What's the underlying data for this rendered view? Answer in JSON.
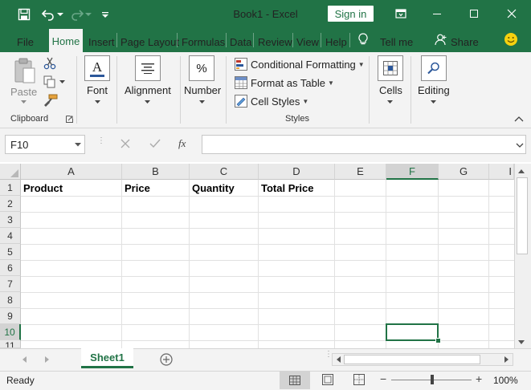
{
  "window": {
    "title": "Book1  -  Excel",
    "signin_label": "Sign in"
  },
  "ribbon_tabs": {
    "file": "File",
    "home": "Home",
    "insert": "Insert",
    "page_layout": "Page Layout",
    "formulas": "Formulas",
    "data": "Data",
    "review": "Review",
    "view": "View",
    "help": "Help",
    "tell_me": "Tell me",
    "share": "Share"
  },
  "ribbon": {
    "clipboard": {
      "paste": "Paste",
      "group_label": "Clipboard"
    },
    "font": {
      "label": "Font",
      "icon_letter": "A"
    },
    "alignment": {
      "label": "Alignment"
    },
    "number": {
      "label": "Number",
      "icon_symbol": "%"
    },
    "styles": {
      "conditional_formatting": "Conditional Formatting",
      "format_as_table": "Format as Table",
      "cell_styles": "Cell Styles",
      "group_label": "Styles"
    },
    "cells": {
      "label": "Cells"
    },
    "editing": {
      "label": "Editing"
    }
  },
  "formula_bar": {
    "name_box": "F10",
    "fx_symbol": "fx",
    "formula": ""
  },
  "grid": {
    "columns": [
      "A",
      "B",
      "C",
      "D",
      "E",
      "F",
      "G",
      "I"
    ],
    "selected_column": "F",
    "rows": [
      "1",
      "2",
      "3",
      "4",
      "5",
      "6",
      "7",
      "8",
      "9",
      "10",
      "11"
    ],
    "selected_row": "10",
    "header_row": {
      "A": "Product",
      "B": "Price",
      "C": "Quantity",
      "D": "Total Price"
    },
    "active_cell": "F10"
  },
  "sheets": {
    "tabs": [
      "Sheet1"
    ],
    "active": "Sheet1"
  },
  "status": {
    "text": "Ready",
    "zoom": "100%",
    "zoom_minus": "−",
    "zoom_plus": "+"
  },
  "colors": {
    "accent": "#217346",
    "ribbon_bg": "#f3f3f3",
    "header_bg": "#e9e9e9"
  }
}
